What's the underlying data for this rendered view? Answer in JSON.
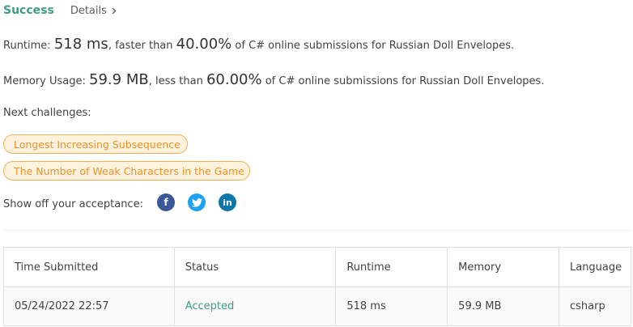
{
  "header": {
    "status": "Success",
    "details_label": "Details"
  },
  "runtime": {
    "label": "Runtime: ",
    "value": "518 ms",
    "mid": ", faster than ",
    "percent": "40.00%",
    "tail": " of C# online submissions for Russian Doll Envelopes."
  },
  "memory": {
    "label": "Memory Usage: ",
    "value": "59.9 MB",
    "mid": ", less than ",
    "percent": "60.00%",
    "tail": " of C# online submissions for Russian Doll Envelopes."
  },
  "next_challenges": {
    "label": "Next challenges:",
    "items": [
      "Longest Increasing Subsequence",
      "The Number of Weak Characters in the Game"
    ]
  },
  "share": {
    "label": "Show off your acceptance:",
    "icons": [
      "facebook-icon",
      "twitter-icon",
      "linkedin-icon"
    ]
  },
  "table": {
    "headers": [
      "Time Submitted",
      "Status",
      "Runtime",
      "Memory",
      "Language"
    ],
    "rows": [
      [
        "05/24/2022 22:57",
        "Accepted",
        "518 ms",
        "59.9 MB",
        "csharp"
      ]
    ]
  },
  "colors": {
    "accent": "#3d9c87",
    "chip_text": "#e8932a",
    "chip_bg": "#fff2dd",
    "facebook": "#3b5998",
    "twitter": "#1da1f2",
    "linkedin": "#0e76a8"
  }
}
